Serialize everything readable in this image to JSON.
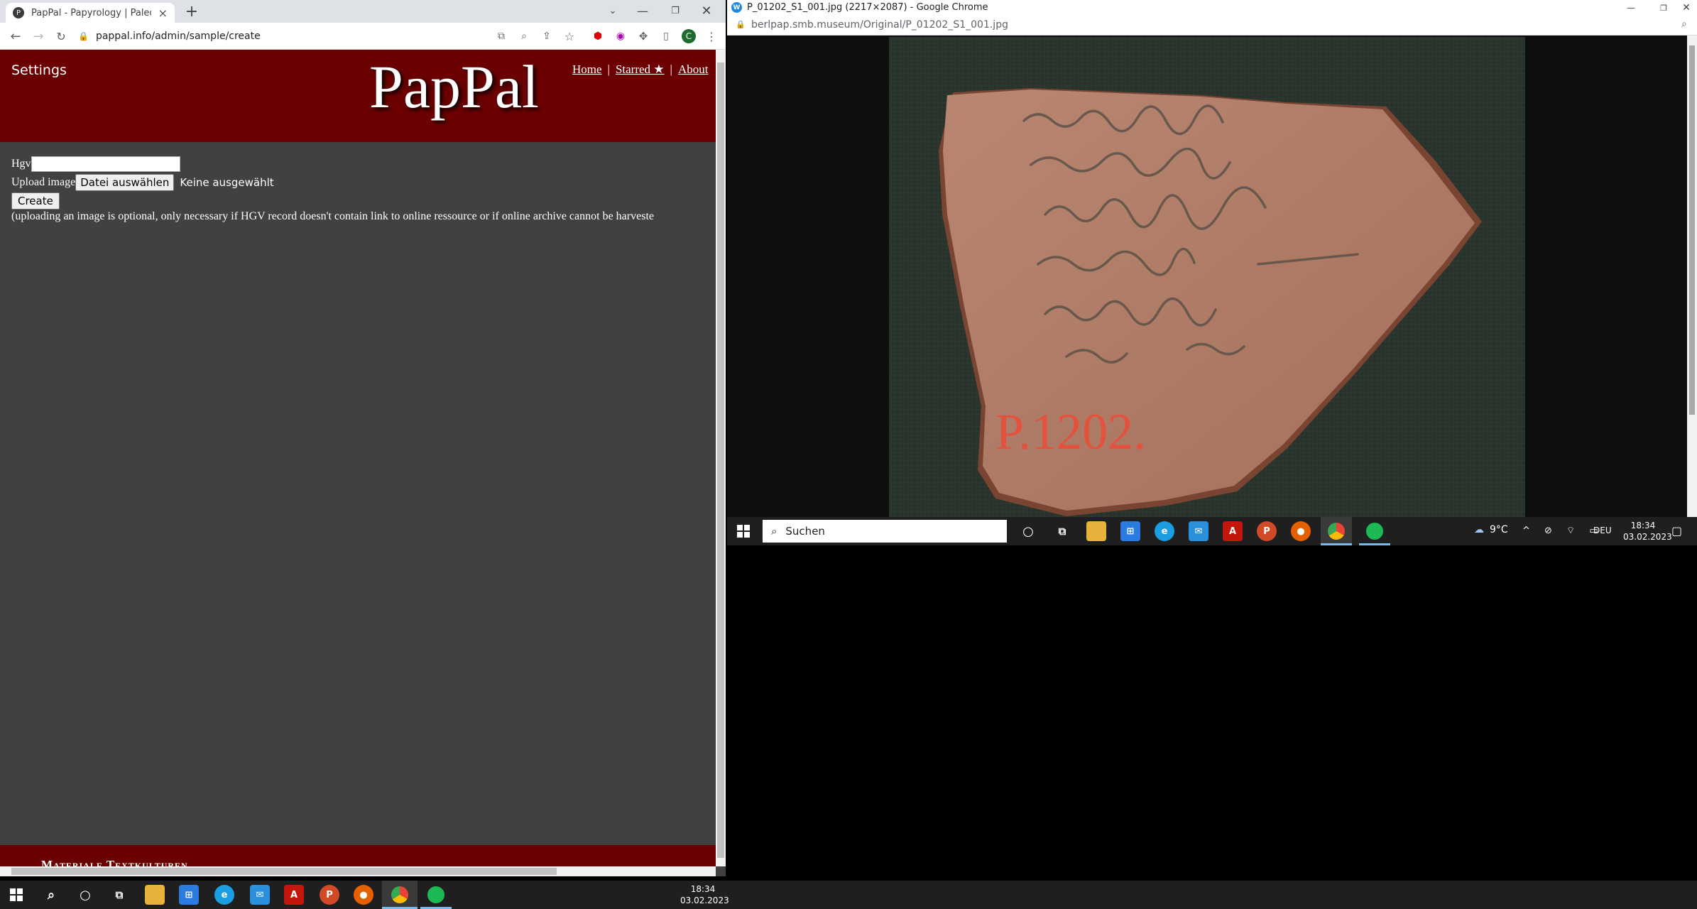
{
  "left_window": {
    "tab_title": "PapPal - Papyrology | Paleograph",
    "tab_favicon": "P",
    "new_tab": "+",
    "url": "pappal.info/admin/sample/create"
  },
  "page": {
    "settings_label": "Settings",
    "logo": "PapPal",
    "nav": {
      "home": "Home",
      "sep1": "|",
      "starred": "Starred ★",
      "sep2": "|",
      "about": "About"
    },
    "form": {
      "hgv_label": "Hgv",
      "hgv_value": "",
      "upload_label": "Upload image",
      "file_button": "Datei auswählen",
      "file_status": "Keine ausgewählt",
      "create_button": "Create",
      "note": "(uploading an image is optional, only necessary if HGV record doesn't contain link to online ressource or if online archive cannot be harveste"
    },
    "footer_text": "Materiale Textkulturen"
  },
  "right_window": {
    "favicon": "W",
    "title": "P_01202_S1_001.jpg (2217×2087) - Google Chrome",
    "url": "berlpap.smb.museum/Original/P_01202_S1_001.jpg",
    "photo_label": "P.1202."
  },
  "right_taskbar": {
    "search_placeholder": "Suchen",
    "weather": "9°C",
    "lang": "DEU",
    "time": "18:34",
    "date": "03.02.2023"
  },
  "main_taskbar": {
    "time": "18:34",
    "date": "03.02.2023"
  },
  "colors": {
    "header_red": "#6b0000",
    "page_bg": "#414141",
    "sherd": "#b07a64"
  }
}
